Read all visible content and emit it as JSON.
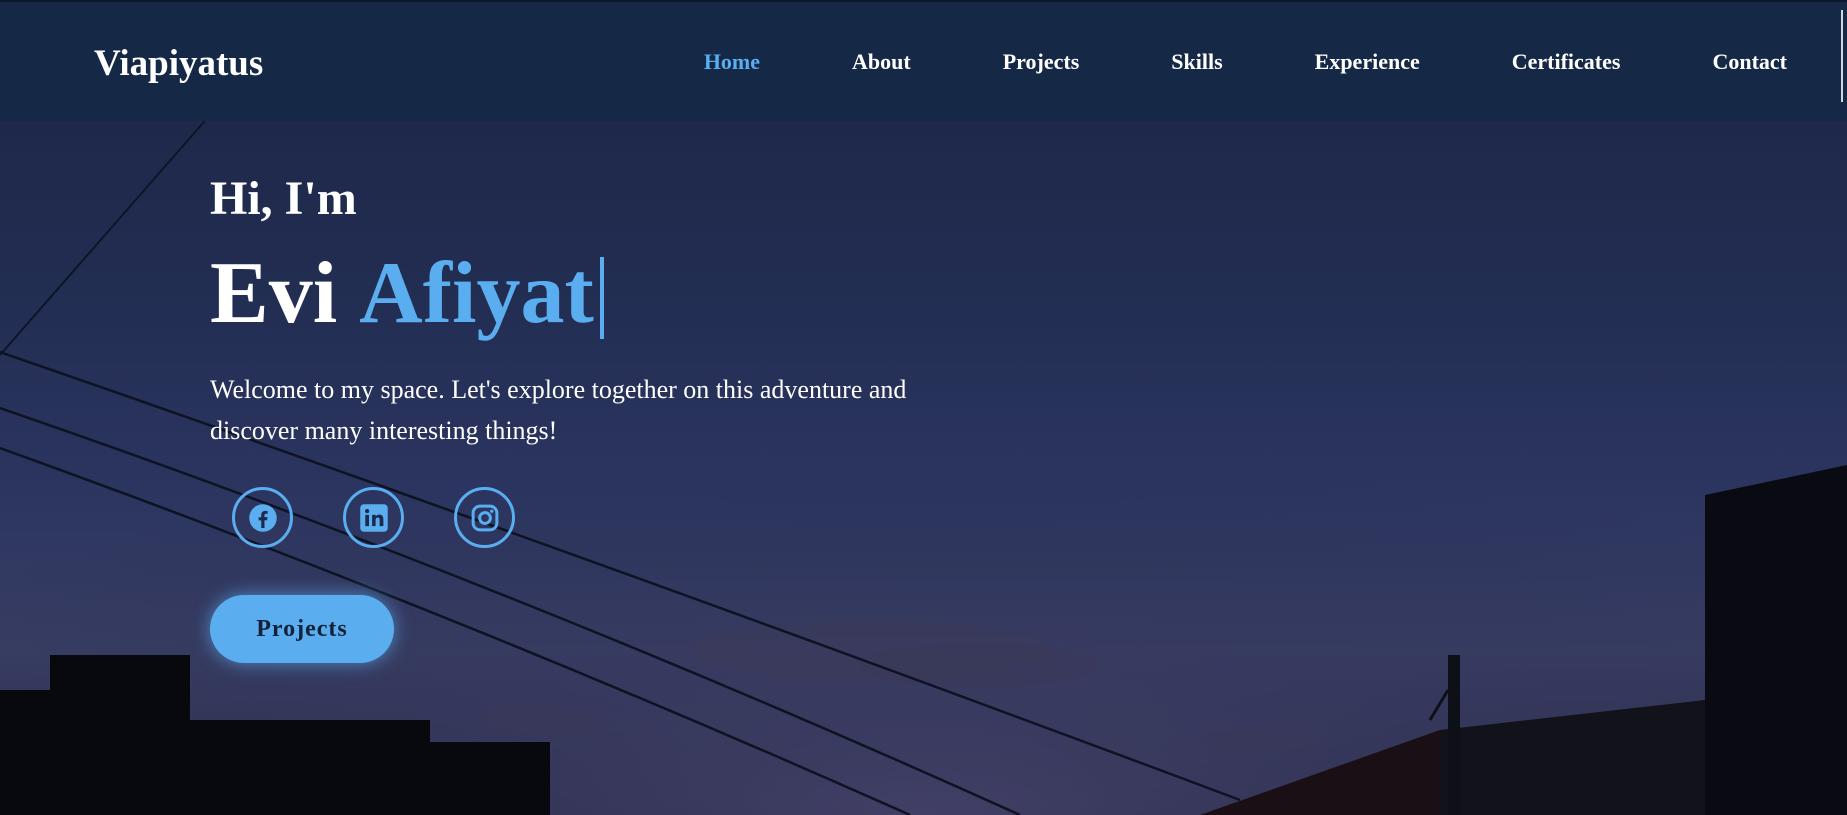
{
  "brand": {
    "name": "Viapiyatus"
  },
  "nav": {
    "items": [
      {
        "label": "Home",
        "active": true
      },
      {
        "label": "About",
        "active": false
      },
      {
        "label": "Projects",
        "active": false
      },
      {
        "label": "Skills",
        "active": false
      },
      {
        "label": "Experience",
        "active": false
      },
      {
        "label": "Certificates",
        "active": false
      },
      {
        "label": "Contact",
        "active": false
      }
    ]
  },
  "hero": {
    "greeting": "Hi, I'm",
    "first_name": "Evi",
    "last_name": "Afiyat",
    "tagline": "Welcome to my space. Let's explore together on this adventure and discover many interesting things!",
    "cta_label": "Projects"
  },
  "socials": [
    {
      "icon": "facebook-icon"
    },
    {
      "icon": "linkedin-icon"
    },
    {
      "icon": "instagram-icon"
    }
  ],
  "colors": {
    "accent": "#5aaef0",
    "navbar": "#152846",
    "text": "#ffffff"
  }
}
